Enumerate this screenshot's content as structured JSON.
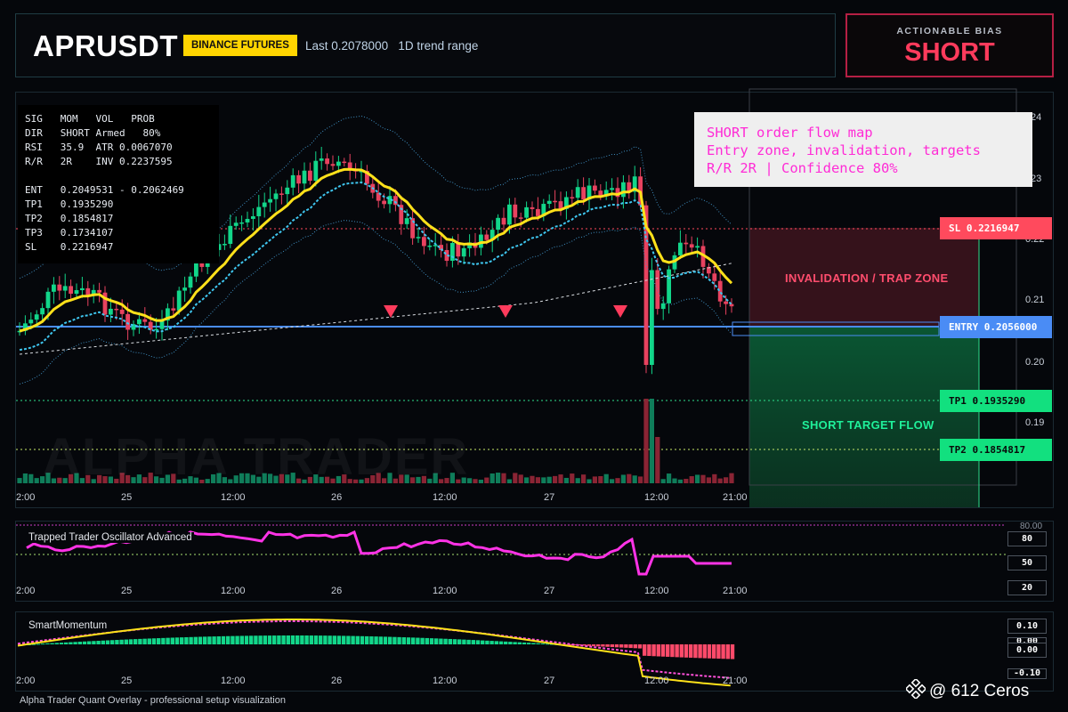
{
  "header": {
    "symbol": "APRUSDT",
    "exchange": "BINANCE FUTURES",
    "last_info": "Last 0.2078000   1D trend range"
  },
  "bias": {
    "label": "ACTIONABLE BIAS",
    "value": "SHORT"
  },
  "stats": {
    "rows": [
      "SIG   MOM   VOL   PROB",
      "DIR   SHORT Armed   80%",
      "RSI   35.9  ATR 0.0067070",
      "R/R   2R    INV 0.2237595",
      "",
      "ENT   0.2049531 - 0.2062469",
      "TP1   0.1935290",
      "TP2   0.1854817",
      "TP3   0.1734107",
      "SL    0.2216947"
    ]
  },
  "info_box": {
    "line1": "SHORT order flow map",
    "line2": "Entry zone, invalidation, targets",
    "line3": "R/R 2R | Confidence 80%"
  },
  "levels": {
    "sl": "SL 0.2216947",
    "entry": "ENTRY 0.2056000",
    "tp1": "TP1 0.1935290",
    "tp2": "TP2 0.1854817"
  },
  "zones": {
    "trap": "INVALIDATION / TRAP ZONE",
    "target": "SHORT TARGET FLOW"
  },
  "watermark": "ALPHA TRADER",
  "price_axis": [
    "24",
    "23",
    "0.22",
    "0.21",
    "0.20",
    "0.19"
  ],
  "time_axis": [
    "2:00",
    "25",
    "12:00",
    "26",
    "12:00",
    "27",
    "12:00",
    "21:00"
  ],
  "oscillator": {
    "title": "Trapped Trader Oscillator Advanced",
    "top_tick": "80.00",
    "values_shown": [
      "80",
      "50",
      "20"
    ]
  },
  "momentum": {
    "title": "SmartMomentum",
    "values_shown": [
      "0.10",
      "0.00",
      "0.00",
      "-0.10"
    ]
  },
  "footer": "Alpha Trader Quant Overlay - professional setup visualization",
  "author": "@ 612 Ceros",
  "colors": {
    "bull": "#12d68a",
    "bear": "#e8425f",
    "ema": "#ffe11a",
    "accent_pink": "#ff2bd6",
    "entry_blue": "#4a8cf5"
  }
}
